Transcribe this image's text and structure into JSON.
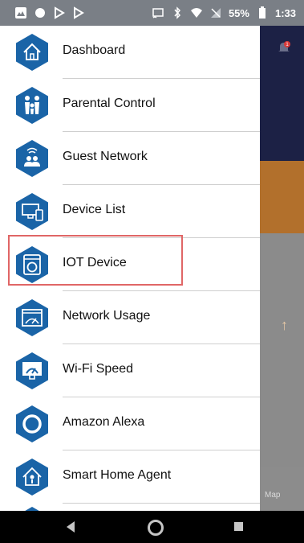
{
  "status_bar": {
    "battery_percent": "55%",
    "time": "1:33",
    "left_icons": [
      "mountain-icon",
      "circle-icon",
      "play-store-icon",
      "play-store-icon"
    ],
    "right_icons": [
      "cast-icon",
      "bluetooth-icon",
      "wifi-icon",
      "signal-icon",
      "battery-icon"
    ]
  },
  "drawer": {
    "items": [
      {
        "label": "Dashboard",
        "icon": "house-icon"
      },
      {
        "label": "Parental Control",
        "icon": "family-icon"
      },
      {
        "label": "Guest Network",
        "icon": "guest-network-icon"
      },
      {
        "label": "Device List",
        "icon": "devices-icon"
      },
      {
        "label": "IOT Device",
        "icon": "iot-device-icon"
      },
      {
        "label": "Network Usage",
        "icon": "network-usage-icon"
      },
      {
        "label": "Wi-Fi Speed",
        "icon": "wifi-speed-icon"
      },
      {
        "label": "Amazon Alexa",
        "icon": "alexa-icon"
      },
      {
        "label": "Smart Home Agent",
        "icon": "smart-home-agent-icon"
      }
    ]
  },
  "background_app": {
    "map_label": "Map",
    "notification_count": "1"
  },
  "colors": {
    "icon_blue": "#1a64a7",
    "drawer_background": "#ffffff",
    "highlight_border": "#e06666",
    "status_bar": "#7a7f86",
    "app_header": "#1c2145",
    "app_accent": "#b2702c"
  }
}
